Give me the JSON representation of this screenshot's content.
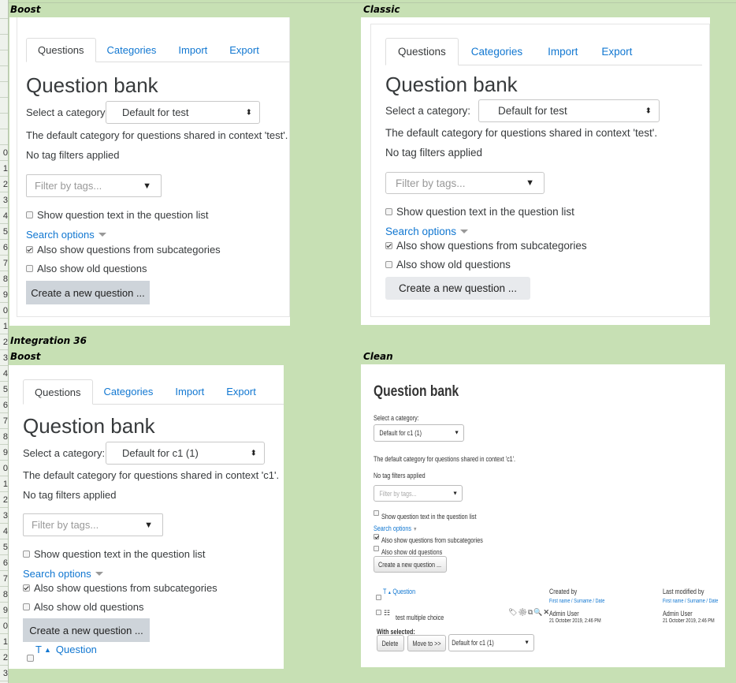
{
  "row_numbers": [
    "",
    "",
    "",
    "",
    "",
    "",
    "",
    "",
    "",
    "0",
    "1",
    "2",
    "3",
    "4",
    "5",
    "6",
    "7",
    "8",
    "9",
    "0",
    "1",
    "2",
    "3",
    "4",
    "5",
    "6",
    "7",
    "8",
    "9",
    "0",
    "1",
    "2",
    "3",
    "4",
    "5",
    "6",
    "7",
    "8",
    "9",
    "0",
    "1",
    "2",
    "3"
  ],
  "sections": {
    "top_left": "Boost",
    "top_right": "Classic",
    "integration": "Integration 36",
    "bottom_left": "Boost",
    "bottom_right": "Clean"
  },
  "tabs": [
    "Questions",
    "Categories",
    "Import",
    "Export"
  ],
  "title": "Question bank",
  "select_category_label": "Select a category:",
  "panel_boost_top": {
    "category": "Default for test",
    "context_text": "The default category for questions shared in context 'test'."
  },
  "panel_boost_bottom": {
    "category": "Default for c1 (1)",
    "context_text": "The default category for questions shared in context 'c1'.",
    "sort_t": "T",
    "question_col": "Question"
  },
  "no_tag_filters": "No tag filters applied",
  "filter_placeholder": "Filter by tags...",
  "show_question_text": "Show question text in the question list",
  "search_options": "Search options",
  "also_subcategories": "Also show questions from subcategories",
  "also_old": "Also show old questions",
  "create_button": "Create a new question ...",
  "clean": {
    "title": "Question bank",
    "select_label": "Select a category:",
    "category": "Default for c1 (1)",
    "context_text": "The default category for questions shared in context 'c1'.",
    "no_tag": "No tag filters applied",
    "filter": "Filter by tags...",
    "show_question_text": "Show question text in the question list",
    "search_options": "Search options",
    "also_subcategories": "Also show questions from subcategories",
    "also_old": "Also show old questions",
    "create_button": "Create a new question ...",
    "col_t": "T",
    "col_question": "Question",
    "col_created": "Created by",
    "col_modified": "Last modified by",
    "sort_created": "First name / Surname / Date",
    "sort_modified": "First name / Surname / Date",
    "row_question": "test multiple choice",
    "row_created_user": "Admin User",
    "row_created_date": "21 October 2019, 2:46 PM",
    "row_modified_user": "Admin User",
    "row_modified_date": "21 October 2019, 2:46 PM",
    "with_selected": "With selected:",
    "delete_button": "Delete",
    "move_button": "Move to >>",
    "move_target": "Default for c1 (1)"
  }
}
